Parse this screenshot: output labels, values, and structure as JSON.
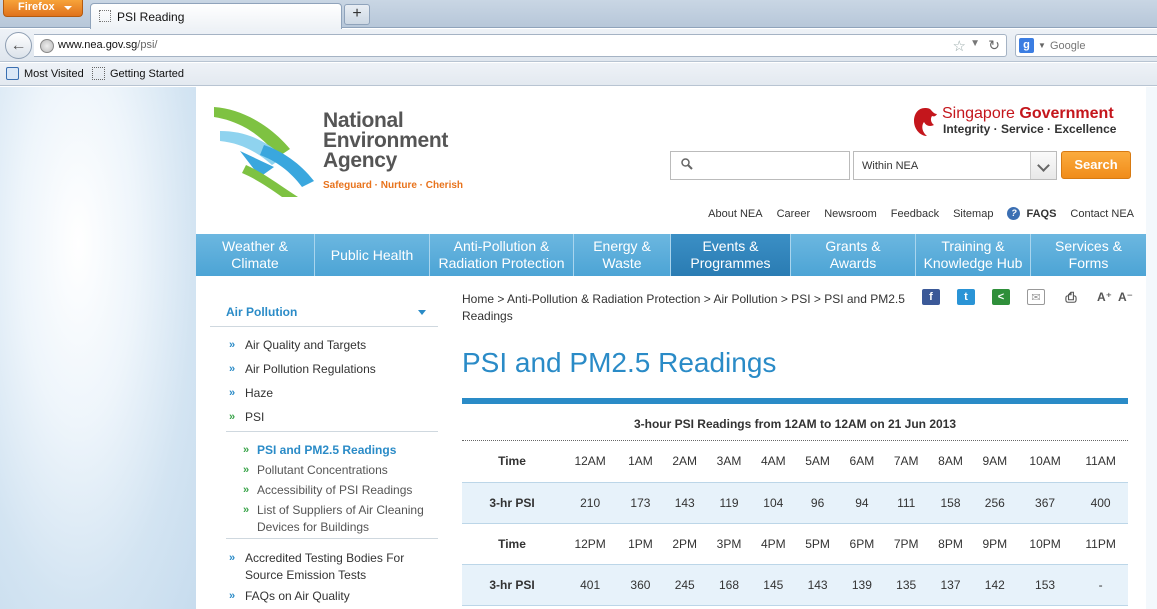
{
  "browser": {
    "menu_label": "Firefox",
    "tab_title": "PSI Reading",
    "new_tab": "+",
    "url_host": "www.nea.gov.sg",
    "url_path": "/psi/",
    "search_engine_placeholder": "Google",
    "bookmarks": [
      "Most Visited",
      "Getting Started"
    ]
  },
  "header": {
    "agency_line1": "National",
    "agency_line2": "Environment",
    "agency_line3": "Agency",
    "tagline": "Safeguard · Nurture · Cherish",
    "sg_word1": "Singapore",
    "sg_word2": "Government",
    "sg_sub": "Integrity · Service · Excellence",
    "search_placeholder": "",
    "within_value": "Within NEA",
    "search_button": "Search"
  },
  "util_links": {
    "about": "About NEA",
    "career": "Career",
    "newsroom": "Newsroom",
    "feedback": "Feedback",
    "sitemap": "Sitemap",
    "faqs": "FAQS",
    "contact": "Contact NEA"
  },
  "nav": [
    {
      "line1": "Weather &",
      "line2": "Climate"
    },
    {
      "line1": "Public Health",
      "line2": ""
    },
    {
      "line1": "Anti-Pollution &",
      "line2": "Radiation Protection"
    },
    {
      "line1": "Energy &",
      "line2": "Waste"
    },
    {
      "line1": "Events &",
      "line2": "Programmes"
    },
    {
      "line1": "Grants &",
      "line2": "Awards"
    },
    {
      "line1": "Training &",
      "line2": "Knowledge Hub"
    },
    {
      "line1": "Services &",
      "line2": "Forms"
    }
  ],
  "sidebar": {
    "heading": "Air Pollution",
    "items": [
      "Air Quality and Targets",
      "Air Pollution Regulations",
      "Haze",
      "PSI"
    ],
    "sub_items": [
      "PSI and PM2.5 Readings",
      "Pollutant Concentrations",
      "Accessibility of PSI Readings",
      "List of Suppliers of Air Cleaning",
      "Devices for Buildings"
    ],
    "after_items": [
      "Accredited Testing Bodies For",
      "Source Emission Tests",
      "FAQs on Air Quality"
    ]
  },
  "breadcrumb": {
    "line1": "Home > Anti-Pollution & Radiation Protection > Air Pollution > PSI > PSI and PM2.5",
    "line2": "Readings"
  },
  "share": {
    "font_up": "A⁺",
    "font_down": "A⁻"
  },
  "content": {
    "title": "PSI and PM2.5 Readings",
    "table_caption": "3-hour PSI Readings from 12AM to 12AM on 21 Jun 2013",
    "time_label": "Time",
    "psi_label": "3-hr PSI",
    "hours_am": [
      "12AM",
      "1AM",
      "2AM",
      "3AM",
      "4AM",
      "5AM",
      "6AM",
      "7AM",
      "8AM",
      "9AM",
      "10AM",
      "11AM"
    ],
    "psi_am": [
      "210",
      "173",
      "143",
      "119",
      "104",
      "96",
      "94",
      "111",
      "158",
      "256",
      "367",
      "400"
    ],
    "hours_pm": [
      "12PM",
      "1PM",
      "2PM",
      "3PM",
      "4PM",
      "5PM",
      "6PM",
      "7PM",
      "8PM",
      "9PM",
      "10PM",
      "11PM"
    ],
    "psi_pm": [
      "401",
      "360",
      "245",
      "168",
      "145",
      "143",
      "139",
      "135",
      "137",
      "142",
      "153",
      "-"
    ]
  },
  "colors": {
    "nea_blue": "#2a8bc7",
    "nav_blue": "#4ca4d5",
    "search_orange": "#f08c1a",
    "sg_red": "#c4161c"
  }
}
